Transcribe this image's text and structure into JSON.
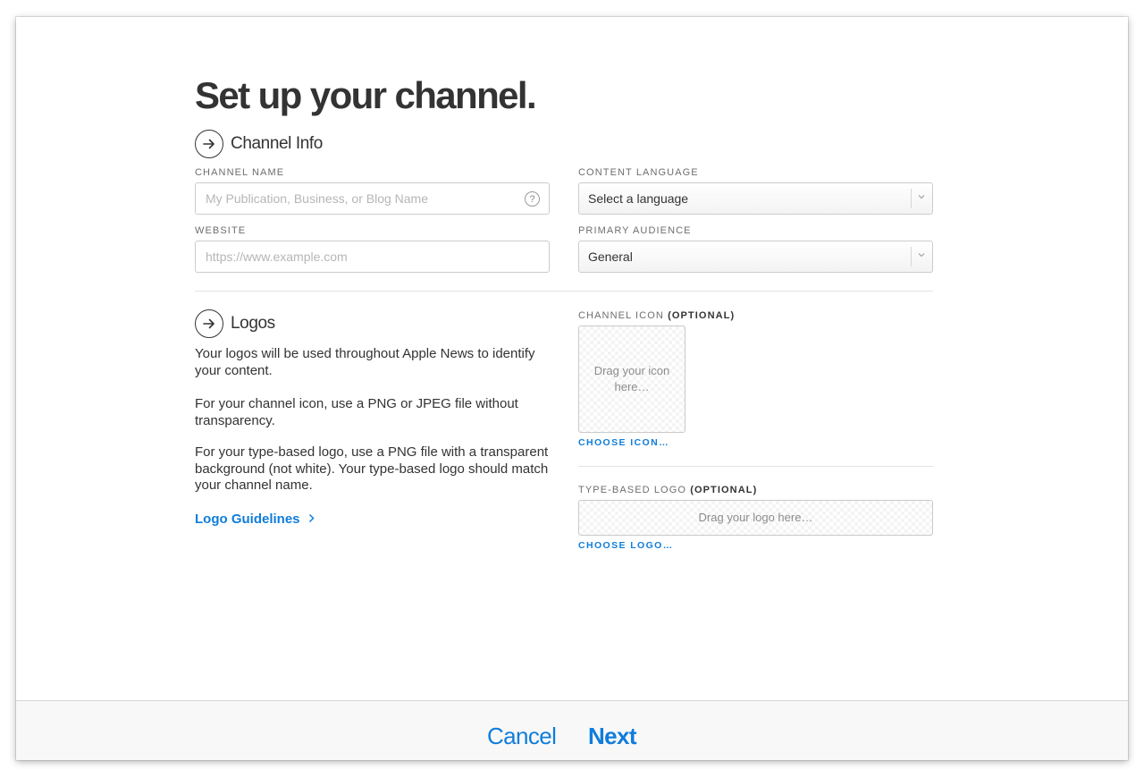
{
  "page": {
    "title": "Set up your channel."
  },
  "channel_info": {
    "heading": "Channel Info",
    "icon": "arrow-right-circle-icon",
    "channel_name": {
      "label": "CHANNEL NAME",
      "value": "",
      "placeholder": "My Publication, Business, or Blog Name",
      "help_icon": "?"
    },
    "website": {
      "label": "WEBSITE",
      "value": "",
      "placeholder": "https://www.example.com"
    },
    "content_language": {
      "label": "CONTENT LANGUAGE",
      "selected": "Select a language"
    },
    "primary_audience": {
      "label": "PRIMARY AUDIENCE",
      "selected": "General"
    }
  },
  "logos": {
    "heading": "Logos",
    "icon": "arrow-right-circle-icon",
    "paragraphs": [
      "Your logos will be used throughout Apple News to identify your content.",
      "For your channel icon, use a PNG or JPEG file without transparency.",
      "For your type-based logo, use a PNG file with a transparent background (not white). Your type-based logo should match your channel name."
    ],
    "guidelines_link": "Logo Guidelines",
    "channel_icon": {
      "label": "CHANNEL ICON",
      "optional": "(OPTIONAL)",
      "drop_text": "Drag your icon here…",
      "choose_link": "CHOOSE ICON…"
    },
    "type_logo": {
      "label": "TYPE-BASED LOGO",
      "optional": "(OPTIONAL)",
      "drop_text": "Drag your logo here…",
      "choose_link": "CHOOSE LOGO…"
    }
  },
  "footer": {
    "cancel_label": "Cancel",
    "next_label": "Next"
  },
  "colors": {
    "accent": "#0f7ddb",
    "text": "#333333",
    "label": "#6e6e6e",
    "footer_bg": "#f8f8f8"
  }
}
